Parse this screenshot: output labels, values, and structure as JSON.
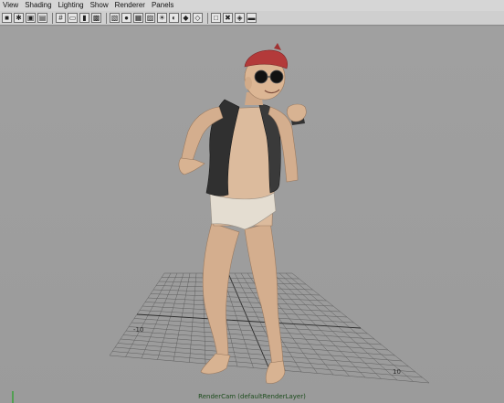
{
  "menu": [
    "View",
    "Shading",
    "Lighting",
    "Show",
    "Renderer",
    "Panels"
  ],
  "toolbar_icons": [
    {
      "name": "select-camera-icon",
      "glyph": "■"
    },
    {
      "name": "camera-attributes-icon",
      "glyph": "✱"
    },
    {
      "name": "bookmark-icon",
      "glyph": "▣"
    },
    {
      "name": "image-plane-icon",
      "glyph": "▤"
    },
    {
      "name": "grid-icon",
      "glyph": "#"
    },
    {
      "name": "film-gate-icon",
      "glyph": "▭"
    },
    {
      "name": "resolution-gate-icon",
      "glyph": "▮"
    },
    {
      "name": "safe-action-icon",
      "glyph": "▩"
    },
    {
      "name": "wireframe-icon",
      "glyph": "▧"
    },
    {
      "name": "smooth-shade-icon",
      "glyph": "●"
    },
    {
      "name": "wireframe-on-shaded-icon",
      "glyph": "▦"
    },
    {
      "name": "textured-icon",
      "glyph": "▨"
    },
    {
      "name": "use-all-lights-icon",
      "glyph": "☀"
    },
    {
      "name": "shadows-icon",
      "glyph": "◐"
    },
    {
      "name": "high-quality-icon",
      "glyph": "◆"
    },
    {
      "name": "xray-icon",
      "glyph": "◇"
    },
    {
      "name": "isolate-select-icon",
      "glyph": "□"
    },
    {
      "name": "xray-joints-icon",
      "glyph": "✖"
    },
    {
      "name": "xray-active-icon",
      "glyph": "◈"
    },
    {
      "name": "lock-camera-icon",
      "glyph": "▬"
    }
  ],
  "grid_labels": {
    "left": "-10",
    "right": "10"
  },
  "camera_label": "RenderCam (defaultRenderLayer)",
  "colors": {
    "viewport": "#9c9c9c",
    "grid": "#5e5e5e",
    "grid_major": "#2a2a2a",
    "skin": "#d9b596",
    "vest": "#2e2e2e",
    "underwear": "#e3dcd0",
    "bandana": "#b33a3a",
    "axis_x": "#d23a3a",
    "axis_y": "#3aa03a",
    "axis_z": "#3a5ad2"
  }
}
